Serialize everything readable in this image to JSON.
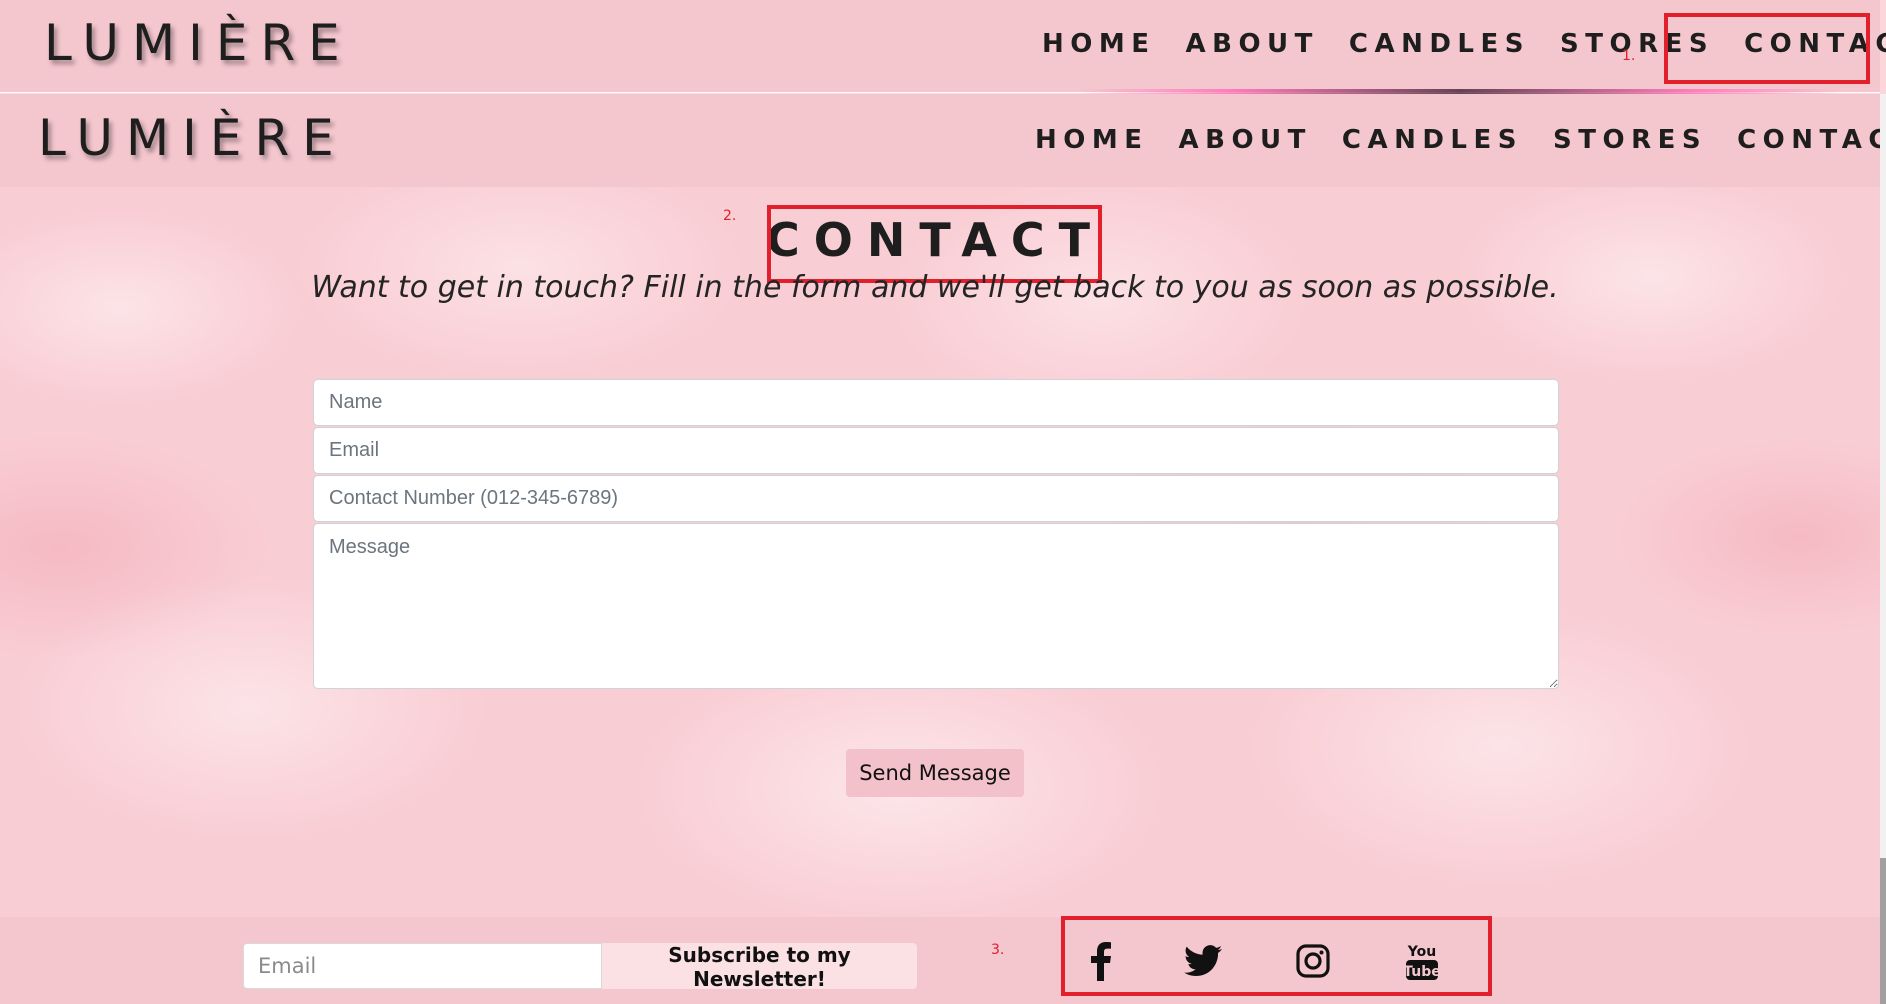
{
  "brand": {
    "logo_text": "LUMIÈRE"
  },
  "nav": {
    "items": [
      "HOME",
      "ABOUT",
      "CANDLES",
      "STORES",
      "CONTACT"
    ]
  },
  "annotations": {
    "one": "1.",
    "two": "2.",
    "three": "3."
  },
  "contact": {
    "heading": "CONTACT",
    "subtitle": "Want to get in touch? Fill in the form and we'll get back to you as soon as possible.",
    "name_placeholder": "Name",
    "email_placeholder": "Email",
    "phone_placeholder": "Contact Number (012-345-6789)",
    "message_placeholder": "Message",
    "send_label": "Send Message"
  },
  "footer": {
    "newsletter_placeholder": "Email",
    "subscribe_label": "Subscribe to my Newsletter!",
    "social": [
      "facebook-icon",
      "twitter-icon",
      "instagram-icon",
      "youtube-icon"
    ]
  },
  "colors": {
    "navbar": "#f4c6ce",
    "annotation_red": "#e2202c",
    "page_background": "#f9cdd4"
  }
}
